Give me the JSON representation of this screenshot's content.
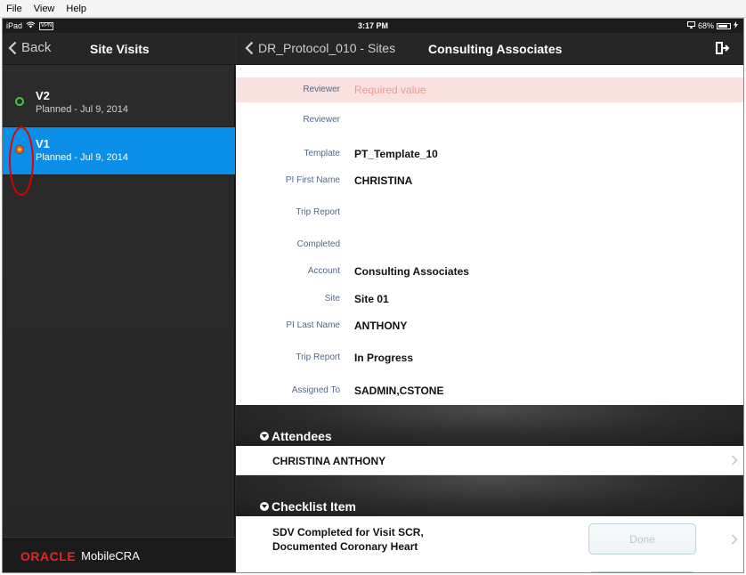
{
  "menubar": {
    "items": [
      "File",
      "View",
      "Help"
    ]
  },
  "statusbar": {
    "device": "iPad",
    "vpn": "VPN",
    "time": "3:17 PM",
    "battery": "68%"
  },
  "left": {
    "back_label": "Back",
    "title": "Site Visits",
    "visits": [
      {
        "name": "V2",
        "subtitle": "Planned - Jul 9, 2014",
        "status": "green"
      },
      {
        "name": "V1",
        "subtitle": "Planned - Jul 9, 2014",
        "status": "orange"
      }
    ],
    "footer": {
      "logo": "ORACLE",
      "product": "MobileCRA"
    }
  },
  "right": {
    "breadcrumb": "DR_Protocol_010 - Sites",
    "title": "Consulting Associates",
    "fields": [
      {
        "label": "Reviewer",
        "value": "Required value",
        "error": true
      },
      {
        "label": "Reviewer",
        "value": ""
      },
      {
        "label": "Template",
        "value": "PT_Template_10"
      },
      {
        "label": "PI First Name",
        "value": "CHRISTINA"
      },
      {
        "label": "Trip Report",
        "value": ""
      },
      {
        "label": "Completed",
        "value": ""
      },
      {
        "label": "Account",
        "value": "Consulting Associates"
      },
      {
        "label": "Site",
        "value": "Site 01"
      },
      {
        "label": "PI Last Name",
        "value": "ANTHONY"
      },
      {
        "label": "Trip Report",
        "value": "In Progress"
      },
      {
        "label": "Assigned To",
        "value": "SADMIN,CSTONE"
      }
    ],
    "attendees": {
      "header": "Attendees",
      "items": [
        "CHRISTINA ANTHONY"
      ]
    },
    "checklist": {
      "header": "Checklist Item",
      "items": [
        {
          "line1": "SDV Completed for Visit SCR,",
          "line2": "Documented Coronary Heart",
          "button": "Done"
        }
      ]
    }
  },
  "colors": {
    "selected_row": "#0a8ee8",
    "error_bg": "#f8e1df",
    "oracle_red": "#e8271c",
    "label": "#53688a"
  }
}
